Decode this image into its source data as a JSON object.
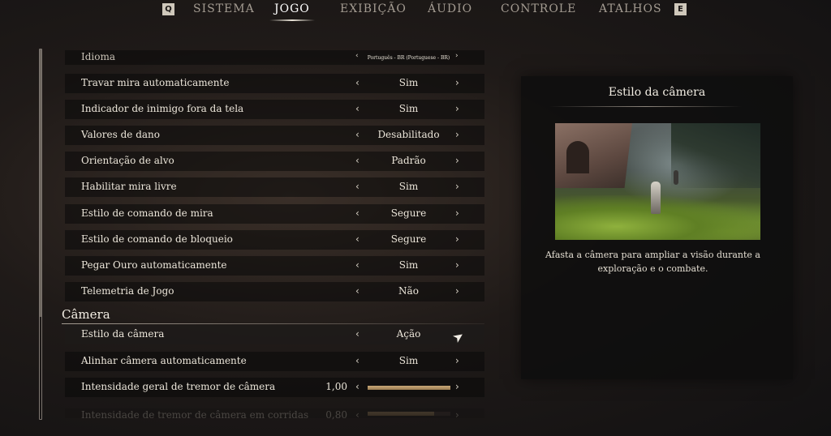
{
  "tabs": {
    "left_key": "Q",
    "right_key": "E",
    "items": [
      {
        "label": "SISTEMA",
        "active": false
      },
      {
        "label": "JOGO",
        "active": true
      },
      {
        "label": "EXIBIÇÃO",
        "active": false
      },
      {
        "label": "ÁUDIO",
        "active": false
      },
      {
        "label": "CONTROLE",
        "active": false
      },
      {
        "label": "ATALHOS",
        "active": false
      }
    ]
  },
  "icons": {
    "left_arrow": "‹",
    "right_arrow": "›",
    "cursor": "➤"
  },
  "settings": [
    {
      "label": "Idioma",
      "value": "Português - BR (Portuguese - BR)"
    },
    {
      "label": "Travar mira automaticamente",
      "value": "Sim"
    },
    {
      "label": "Indicador de inimigo fora da tela",
      "value": "Sim"
    },
    {
      "label": "Valores de dano",
      "value": "Desabilitado"
    },
    {
      "label": "Orientação de alvo",
      "value": "Padrão"
    },
    {
      "label": "Habilitar mira livre",
      "value": "Sim"
    },
    {
      "label": "Estilo de comando de mira",
      "value": "Segure"
    },
    {
      "label": "Estilo de comando de bloqueio",
      "value": "Segure"
    },
    {
      "label": "Pegar Ouro automaticamente",
      "value": "Sim"
    },
    {
      "label": "Telemetria de Jogo",
      "value": "Não"
    }
  ],
  "camera_section": {
    "heading": "Câmera",
    "settings": [
      {
        "label": "Estilo da câmera",
        "value": "Ação"
      },
      {
        "label": "Alinhar câmera automaticamente",
        "value": "Sim"
      }
    ],
    "sliders": [
      {
        "label": "Intensidade geral de tremor de câmera",
        "value": "1,00",
        "level": 1.0
      },
      {
        "label": "Intensidade de tremor de câmera em corridas",
        "value": "0,80",
        "level": 0.8
      }
    ]
  },
  "info_panel": {
    "title": "Estilo da câmera",
    "description": "Afasta a câmera para ampliar a visão durante a exploração e o combate."
  },
  "colors": {
    "slider_fill": "#b8966a",
    "active_tab": "#ffffff",
    "inactive_tab": "#a39b91"
  }
}
